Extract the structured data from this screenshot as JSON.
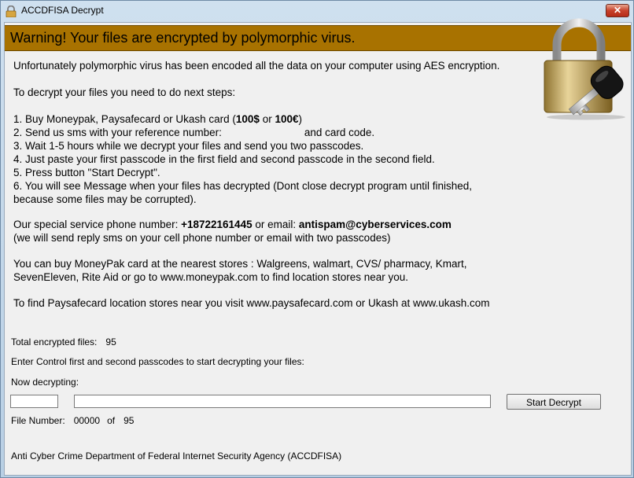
{
  "window": {
    "title": "ACCDFISA Decrypt",
    "close_label": "✕"
  },
  "banner": {
    "text": "Warning! Your files are encrypted by polymorphic virus."
  },
  "message": {
    "intro": "Unfortunately polymorphic virus has been encoded all the data on your computer using AES encryption.",
    "steps_heading": "To decrypt your files you need to do next steps:",
    "step1_a": "1. Buy Moneypak, Paysafecard or Ukash card (",
    "step1_amt1": "100$",
    "step1_b": " or ",
    "step1_amt2": "100€",
    "step1_c": ")",
    "step2_a": "2. Send us sms with your reference number:",
    "step2_b": "and card code.",
    "step3": "3. Wait 1-5 hours while we decrypt your files and send you two passcodes.",
    "step4": "4. Just paste your first passcode in the first field and second passcode in the second field.",
    "step5": "5. Press button \"Start Decrypt\".",
    "step6_line1": "6. You will see Message when your files has decrypted (Dont close decrypt program until finished,",
    "step6_line2": "because some files may be corrupted).",
    "phone_prefix": "Our special service phone number: ",
    "phone": "+18722161445",
    "email_prefix": " or email: ",
    "email": "antispam@cyberservices.com",
    "reply_note": "(we will send reply sms on your cell phone number or email with two passcodes)",
    "moneypak_line1": "You can buy MoneyPak card at the nearest stores : Walgreens, walmart, CVS/ pharmacy, Kmart,",
    "moneypak_line2": "SevenEleven, Rite Aid  or go to www.moneypak.com to find location stores near you.",
    "paysafe_line": "To find Paysafecard location stores near you visit www.paysafecard.com or Ukash at www.ukash.com"
  },
  "status": {
    "total_label": "Total encrypted files:",
    "total_value": "95",
    "enter_label": "Enter Control first and second passcodes to start decrypting your files:",
    "now_decrypting_label": "Now decrypting:",
    "file_number_label": "File Number:",
    "file_number_value": "00000",
    "of_label": "of",
    "file_total_value": "95"
  },
  "inputs": {
    "passcode1_value": "",
    "passcode2_value": ""
  },
  "buttons": {
    "start_decrypt": "Start Decrypt"
  },
  "footer": {
    "text": "Anti Cyber Crime Department of Federal Internet Security Agency (ACCDFISA)"
  },
  "icons": {
    "title": "padlock-icon",
    "banner": "padlock-key-icon"
  },
  "colors": {
    "banner": "#a87200",
    "close_button": "#c7412b"
  }
}
